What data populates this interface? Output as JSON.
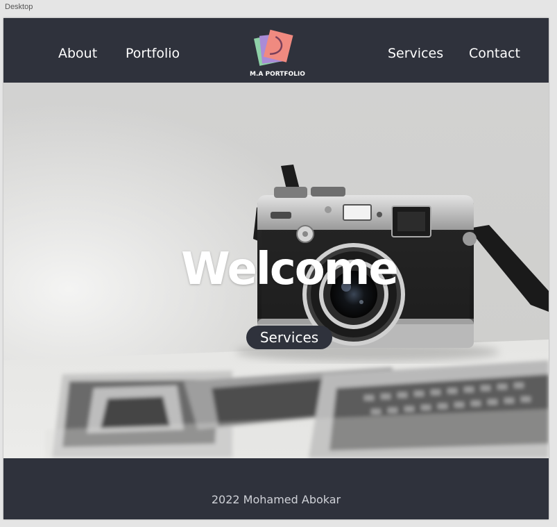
{
  "window": {
    "artboard_label": "Desktop"
  },
  "header": {
    "nav_left": [
      "About",
      "Portfolio"
    ],
    "nav_right": [
      "Services",
      "Contact"
    ],
    "logo_text": "M.A PORTFOLIO",
    "logo_icon": "stacked-photos-icon"
  },
  "hero": {
    "heading": "Welcome",
    "button_label": "Services",
    "image": "camera-photo"
  },
  "footer": {
    "text": "2022 Mohamed Abokar"
  },
  "colors": {
    "navbar_bg": "#2f323c",
    "text": "#ffffff",
    "logo_pink": "#f08a80",
    "logo_purple": "#a98bd6",
    "logo_green": "#8fd1a8"
  }
}
